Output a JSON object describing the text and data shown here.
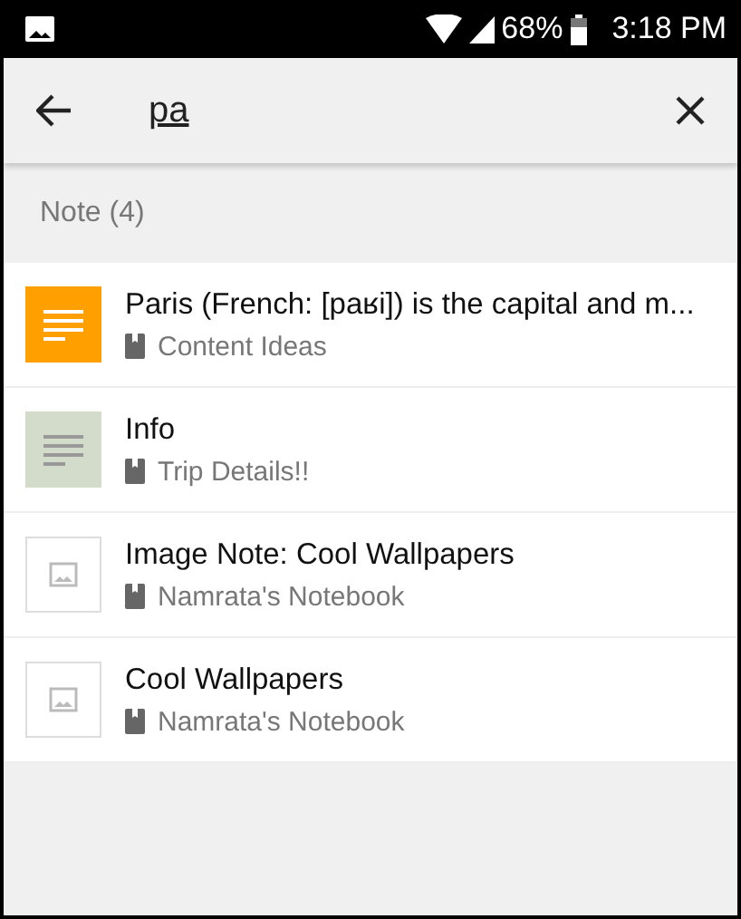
{
  "status_bar": {
    "battery": "68%",
    "time": "3:18 PM"
  },
  "search": {
    "value": "pa"
  },
  "section": {
    "title": "Note (4)"
  },
  "notes": [
    {
      "kind": "text",
      "color": "#ff9f00",
      "title": "Paris (French: [paʁi]) is the capital and m...",
      "notebook": "Content Ideas"
    },
    {
      "kind": "text",
      "color": "#d3dccb",
      "title": "Info",
      "notebook": "Trip Details!!"
    },
    {
      "kind": "image",
      "title": "Image Note: Cool Wallpapers",
      "notebook": "Namrata's Notebook"
    },
    {
      "kind": "image",
      "title": "Cool Wallpapers",
      "notebook": "Namrata's Notebook"
    }
  ]
}
